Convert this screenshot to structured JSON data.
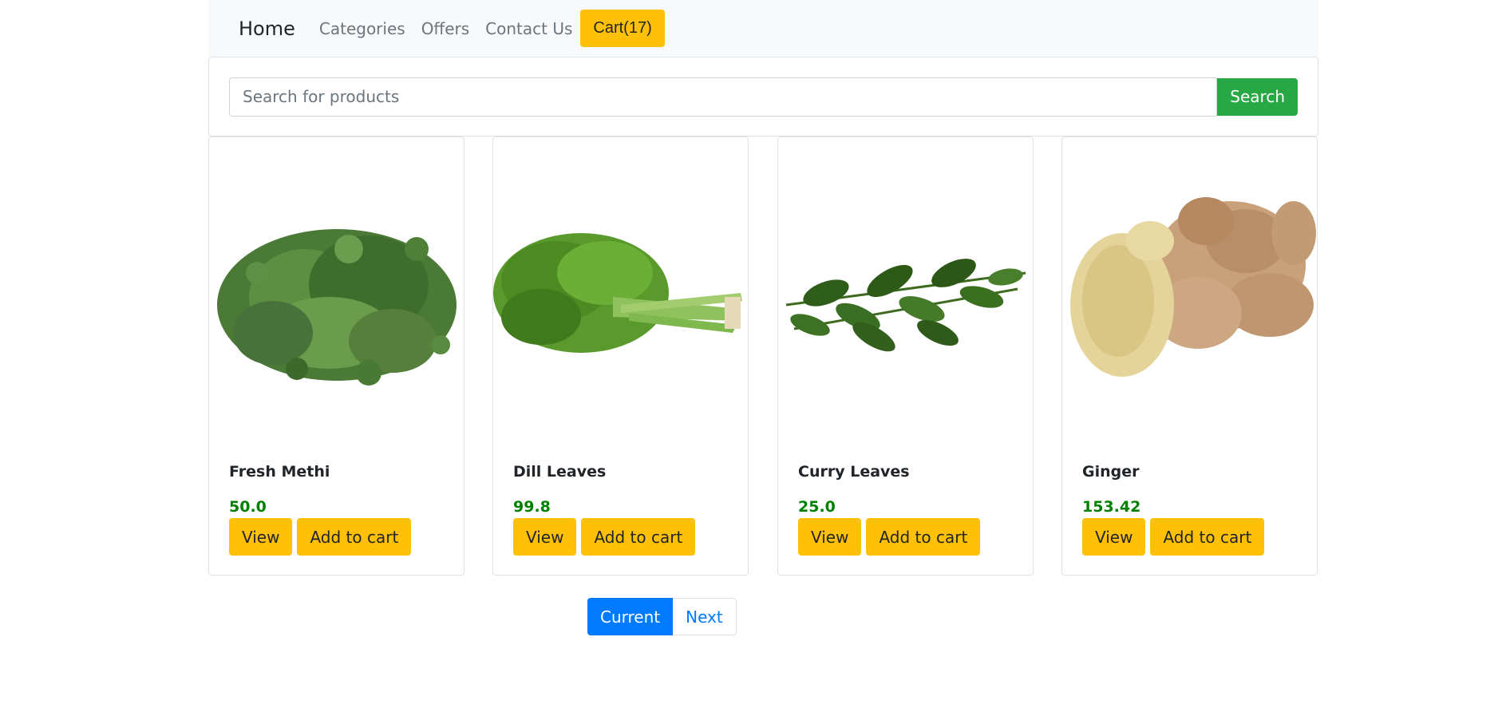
{
  "nav": {
    "brand": "Home",
    "links": [
      "Categories",
      "Offers",
      "Contact Us"
    ],
    "cart_label": "Cart(17)"
  },
  "search": {
    "placeholder": "Search for products",
    "value": "",
    "button_label": "Search"
  },
  "products": [
    {
      "name": "Fresh Methi",
      "price": "50.0",
      "view_label": "View",
      "add_label": "Add to cart",
      "image": "methi-leaves-image"
    },
    {
      "name": "Dill Leaves",
      "price": "99.8",
      "view_label": "View",
      "add_label": "Add to cart",
      "image": "dill-leaves-image"
    },
    {
      "name": "Curry Leaves",
      "price": "25.0",
      "view_label": "View",
      "add_label": "Add to cart",
      "image": "curry-leaves-image"
    },
    {
      "name": "Ginger",
      "price": "153.42",
      "view_label": "View",
      "add_label": "Add to cart",
      "image": "ginger-root-image"
    }
  ],
  "pagination": {
    "current_label": "Current",
    "next_label": "Next"
  },
  "colors": {
    "accent": "#ffc107",
    "search_button": "#28a745",
    "price": "#008000",
    "pager_active": "#007bff"
  }
}
